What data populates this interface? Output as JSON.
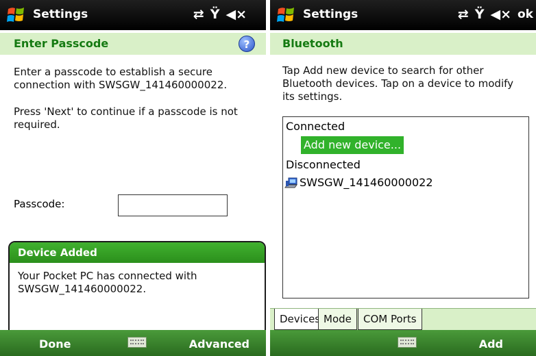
{
  "left": {
    "title": "Settings",
    "header": "Enter Passcode",
    "intro": "Enter a passcode to establish a secure connection with SWSGW_141460000022.",
    "note": "Press 'Next' to continue if a passcode is not required.",
    "passcode_label": "Passcode:",
    "passcode_value": "",
    "notification": {
      "title": "Device Added",
      "body": "Your Pocket PC has connected with SWSGW_141460000022."
    },
    "softkeys": {
      "left": "Done",
      "right": "Advanced"
    }
  },
  "right": {
    "title": "Settings",
    "ok": "ok",
    "header": "Bluetooth",
    "intro": "Tap Add new device to search for other Bluetooth devices. Tap on a device to modify its settings.",
    "list": {
      "connected_label": "Connected",
      "add_new": "Add new device...",
      "disconnected_label": "Disconnected",
      "device": "SWSGW_141460000022"
    },
    "tabs": [
      "Devices",
      "Mode",
      "COM Ports"
    ],
    "softkeys": {
      "left": "",
      "right": "Add"
    }
  },
  "colors": {
    "accent_green": "#31b22b",
    "header_bg": "#d9f0c8",
    "header_text": "#157a12"
  }
}
